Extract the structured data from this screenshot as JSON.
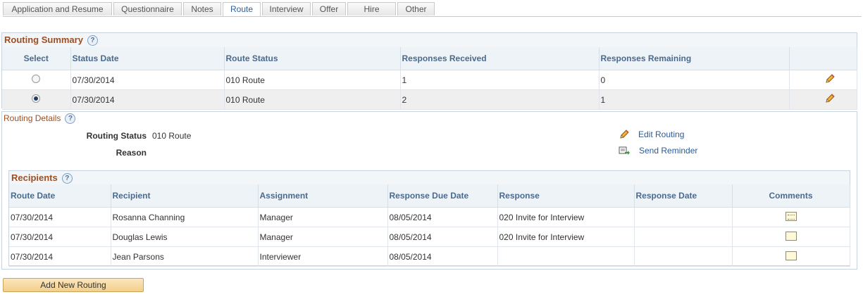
{
  "tabs": [
    "Application and Resume",
    "Questionnaire",
    "Notes",
    "Route",
    "Interview",
    "Offer",
    "Hire",
    "Other"
  ],
  "active_tab": "Route",
  "routing_summary": {
    "title": "Routing Summary",
    "headers": {
      "select": "Select",
      "status_date": "Status Date",
      "route_status": "Route Status",
      "responses_received": "Responses Received",
      "responses_remaining": "Responses Remaining"
    },
    "rows": [
      {
        "selected": false,
        "status_date": "07/30/2014",
        "route_status": "010 Route",
        "responses_received": "1",
        "responses_remaining": "0"
      },
      {
        "selected": true,
        "status_date": "07/30/2014",
        "route_status": "010 Route",
        "responses_received": "2",
        "responses_remaining": "1"
      }
    ]
  },
  "routing_details": {
    "title": "Routing Details",
    "routing_status_label": "Routing Status",
    "routing_status_value": "010 Route",
    "reason_label": "Reason",
    "edit_routing": "Edit Routing",
    "send_reminder": "Send Reminder"
  },
  "recipients": {
    "title": "Recipients",
    "headers": {
      "route_date": "Route Date",
      "recipient": "Recipient",
      "assignment": "Assignment",
      "response_due_date": "Response Due Date",
      "response": "Response",
      "response_date": "Response Date",
      "comments": "Comments"
    },
    "rows": [
      {
        "route_date": "07/30/2014",
        "recipient": "Rosanna Channing",
        "assignment": "Manager",
        "response_due_date": "08/05/2014",
        "response": "020 Invite for Interview",
        "response_date": "",
        "comment_icon": "note-with-text-icon"
      },
      {
        "route_date": "07/30/2014",
        "recipient": "Douglas Lewis",
        "assignment": "Manager",
        "response_due_date": "08/05/2014",
        "response": "020 Invite for Interview",
        "response_date": "",
        "comment_icon": "note-empty-icon"
      },
      {
        "route_date": "07/30/2014",
        "recipient": "Jean Parsons",
        "assignment": "Interviewer",
        "response_due_date": "08/05/2014",
        "response": "",
        "response_date": "",
        "comment_icon": "note-empty-icon"
      }
    ]
  },
  "add_new_routing": "Add New Routing",
  "help_glyph": "?"
}
